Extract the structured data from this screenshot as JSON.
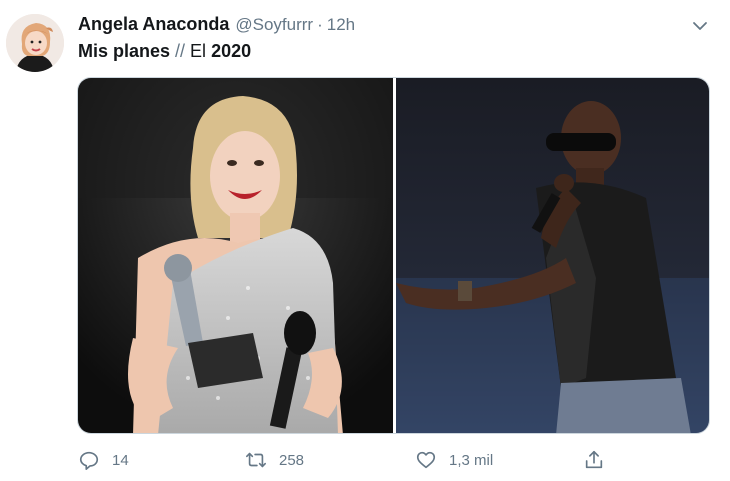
{
  "author": {
    "display_name": "Angela Anaconda",
    "handle": "@Soyfurrr",
    "separator": "·",
    "time": "12h",
    "avatar_icon": "avatar-cartoon-girl"
  },
  "tweet": {
    "text_part1": "Mis planes",
    "text_separator": "//",
    "text_part2": "El",
    "text_part3": "2020"
  },
  "media": {
    "photos": [
      {
        "name": "photo-woman-with-award"
      },
      {
        "name": "photo-man-with-microphone"
      }
    ]
  },
  "actions": {
    "reply_count": "14",
    "retweet_count": "258",
    "like_count": "1,3 mil",
    "reply_icon": "reply-icon",
    "retweet_icon": "retweet-icon",
    "like_icon": "heart-icon",
    "share_icon": "share-icon"
  },
  "colors": {
    "text": "#14171a",
    "secondary": "#657786",
    "border": "#ccd6dd"
  }
}
